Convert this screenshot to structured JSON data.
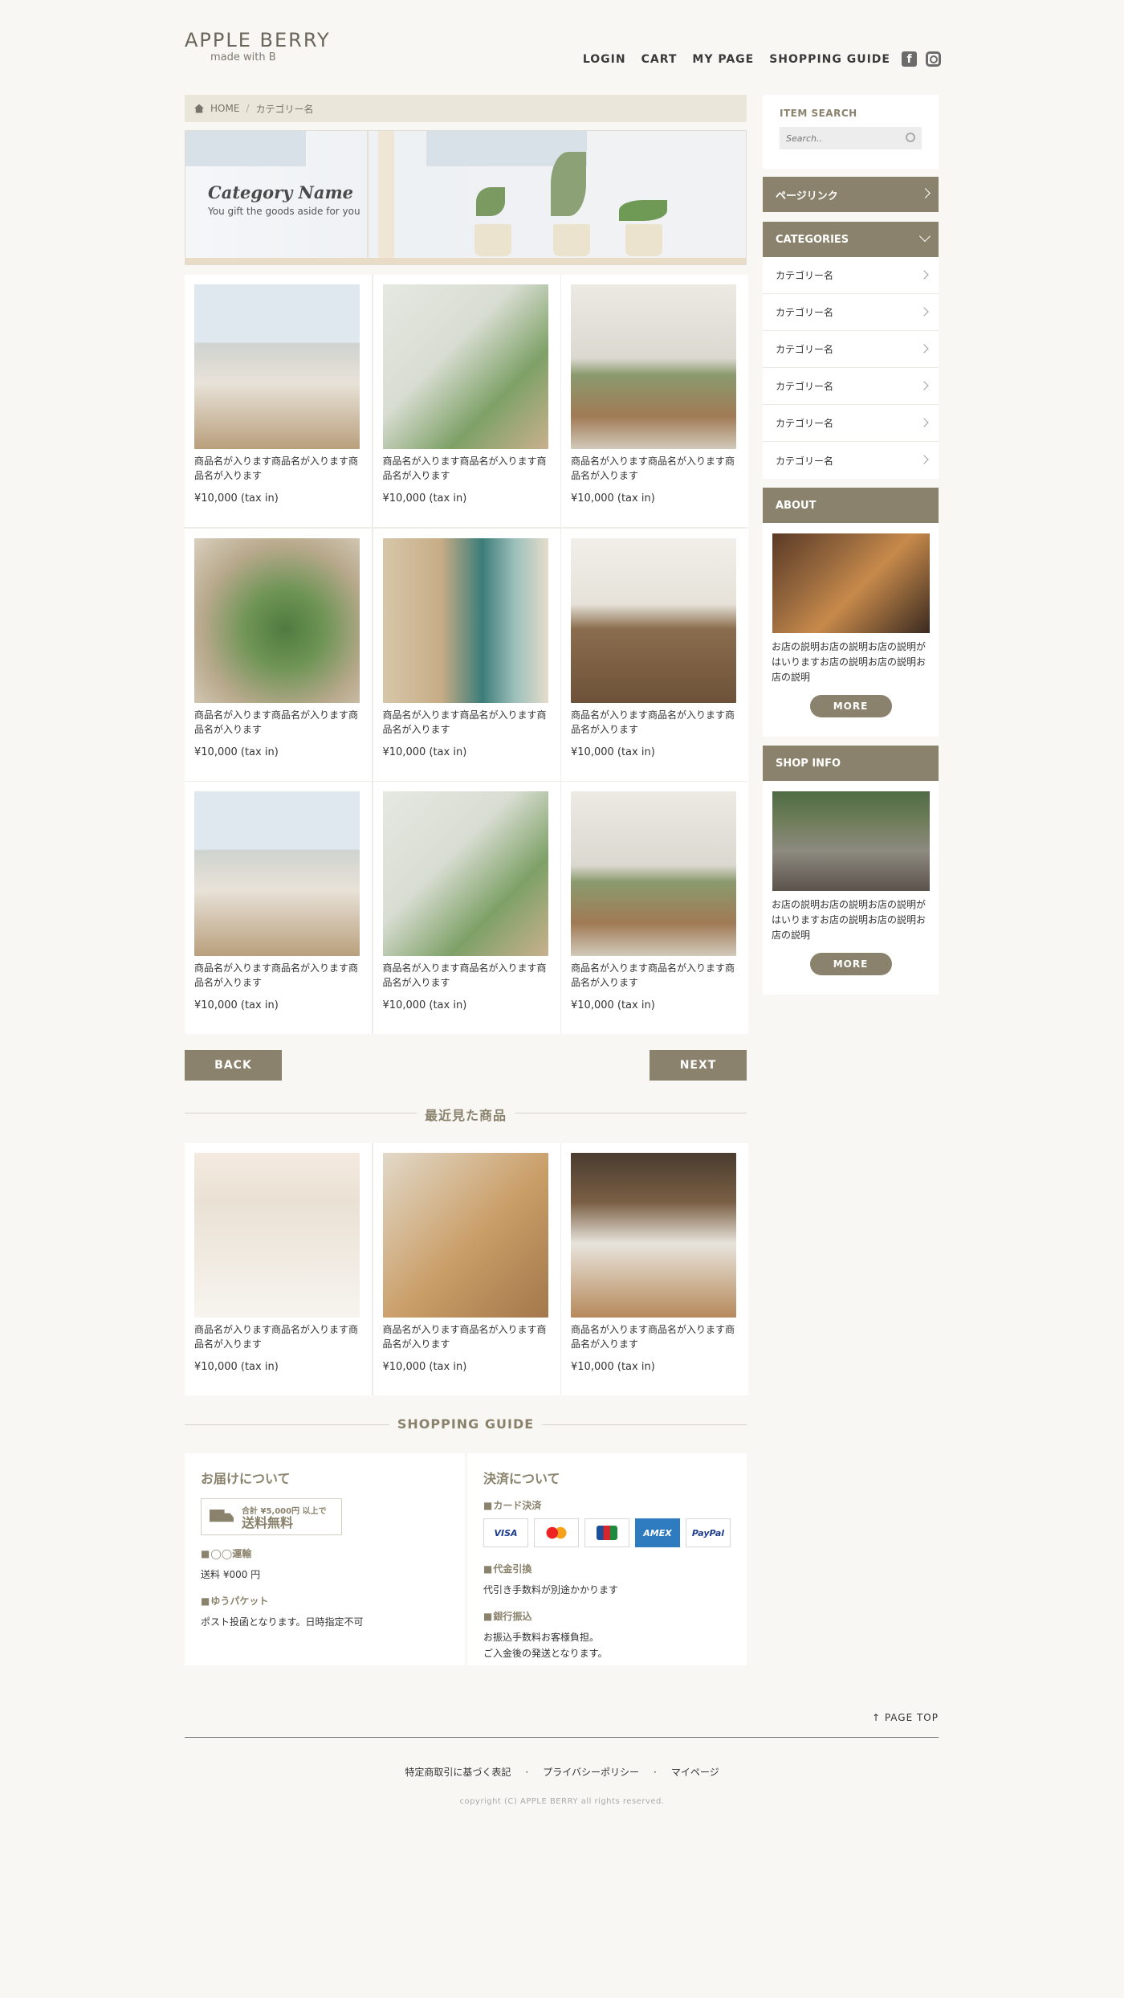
{
  "brand": {
    "name": "APPLE BERRY",
    "tagline": "made with B"
  },
  "nav": {
    "items": [
      "LOGIN",
      "CART",
      "MY PAGE",
      "SHOPPING GUIDE"
    ]
  },
  "breadcrumb": {
    "home": "HOME",
    "sep": "/",
    "current": "カテゴリー名"
  },
  "hero": {
    "title": "Category Name",
    "subtitle": "You gift the goods aside for you"
  },
  "products": [
    {
      "name": "商品名が入ります商品名が入ります商品名が入ります",
      "price": "¥10,000 (tax in)"
    },
    {
      "name": "商品名が入ります商品名が入ります商品名が入ります",
      "price": "¥10,000 (tax in)"
    },
    {
      "name": "商品名が入ります商品名が入ります商品名が入ります",
      "price": "¥10,000 (tax in)"
    },
    {
      "name": "商品名が入ります商品名が入ります商品名が入ります",
      "price": "¥10,000 (tax in)"
    },
    {
      "name": "商品名が入ります商品名が入ります商品名が入ります",
      "price": "¥10,000 (tax in)"
    },
    {
      "name": "商品名が入ります商品名が入ります商品名が入ります",
      "price": "¥10,000 (tax in)"
    },
    {
      "name": "商品名が入ります商品名が入ります商品名が入ります",
      "price": "¥10,000 (tax in)"
    },
    {
      "name": "商品名が入ります商品名が入ります商品名が入ります",
      "price": "¥10,000 (tax in)"
    },
    {
      "name": "商品名が入ります商品名が入ります商品名が入ります",
      "price": "¥10,000 (tax in)"
    }
  ],
  "pager": {
    "back": "BACK",
    "next": "NEXT"
  },
  "recent": {
    "heading": "最近見た商品",
    "items": [
      {
        "name": "商品名が入ります商品名が入ります商品名が入ります",
        "price": "¥10,000 (tax in)"
      },
      {
        "name": "商品名が入ります商品名が入ります商品名が入ります",
        "price": "¥10,000 (tax in)"
      },
      {
        "name": "商品名が入ります商品名が入ります商品名が入ります",
        "price": "¥10,000 (tax in)"
      }
    ]
  },
  "guide": {
    "heading": "SHOPPING GUIDE",
    "delivery": {
      "title": "お届けについて",
      "badge_line1": "合計 ¥5,000円 以上で",
      "badge_line2": "送料無料",
      "method1_title": "◯◯運輸",
      "method1_text": "送料 ¥000 円",
      "method2_title": "ゆうパケット",
      "method2_text": "ポスト投函となります。日時指定不可"
    },
    "payment": {
      "title": "決済について",
      "card_title": "カード決済",
      "cards": [
        "VISA",
        "MasterCard",
        "JCB",
        "AMEX",
        "PayPal"
      ],
      "cod_title": "代金引換",
      "cod_text": "代引き手数料が別途かかります",
      "bank_title": "銀行振込",
      "bank_text1": "お振込手数料お客様負担。",
      "bank_text2": "ご入金後の発送となります。"
    }
  },
  "sidebar": {
    "search_title": "ITEM SEARCH",
    "search_placeholder": "Search..",
    "page_link": "ページリンク",
    "categories_title": "CATEGORIES",
    "categories": [
      "カテゴリー名",
      "カテゴリー名",
      "カテゴリー名",
      "カテゴリー名",
      "カテゴリー名",
      "カテゴリー名"
    ],
    "about_title": "ABOUT",
    "about_text": "お店の説明お店の説明お店の説明がはいりますお店の説明お店の説明お店の説明",
    "shop_title": "SHOP INFO",
    "shop_text": "お店の説明お店の説明お店の説明がはいりますお店の説明お店の説明お店の説明",
    "more": "MORE"
  },
  "footer": {
    "page_top": "PAGE TOP",
    "links": [
      "特定商取引に基づく表記",
      "プライバシーポリシー",
      "マイページ"
    ],
    "copyright": "copyright (C) APPLE BERRY all rights reserved."
  },
  "colors": {
    "accent": "#8a826c",
    "background": "#f8f7f4",
    "breadcrumb_bg": "#ebe6da"
  }
}
